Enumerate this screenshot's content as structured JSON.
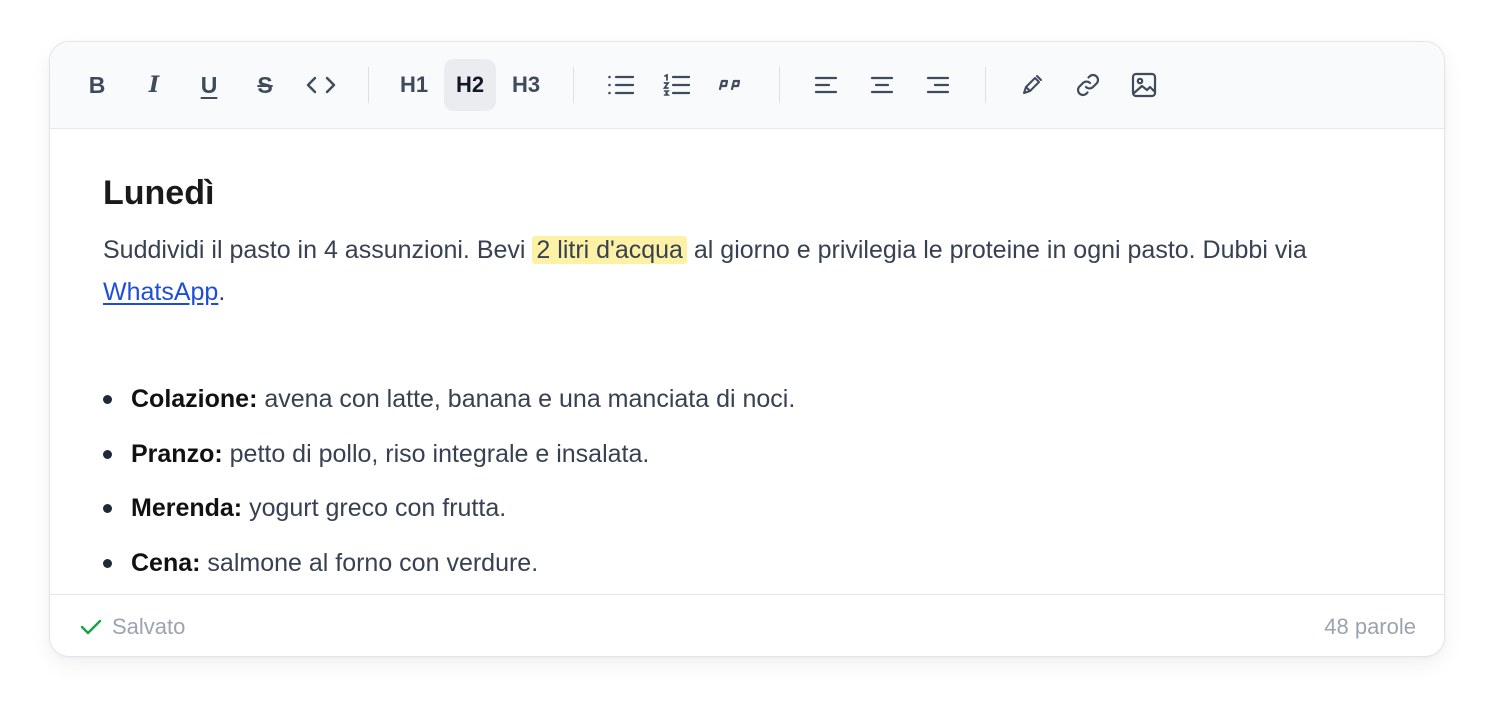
{
  "toolbar": {
    "bold": "B",
    "italic": "I",
    "underline": "U",
    "strike": "S",
    "h1": "H1",
    "h2": "H2",
    "h3": "H3",
    "active_heading": "H2",
    "icons": [
      "code-icon",
      "bullet-list-icon",
      "numbered-list-icon",
      "quote-icon",
      "align-left-icon",
      "align-center-icon",
      "align-right-icon",
      "highlighter-icon",
      "link-icon",
      "image-icon"
    ]
  },
  "document": {
    "title": "Lunedì",
    "paragraph": {
      "before_highlight": "Suddividi il pasto in 4 assunzioni. Bevi ",
      "highlight": "2 litri d'acqua",
      "after_highlight": " al giorno e privilegia le proteine in ogni pasto. Dubbi via ",
      "link": "WhatsApp",
      "end": "."
    },
    "meals": [
      {
        "label": "Colazione:",
        "text": " avena con latte, banana e una manciata di noci."
      },
      {
        "label": "Pranzo:",
        "text": " petto di pollo, riso integrale e insalata."
      },
      {
        "label": "Merenda:",
        "text": " yogurt greco con frutta."
      },
      {
        "label": "Cena:",
        "text": " salmone al forno con verdure."
      }
    ]
  },
  "footer": {
    "status": "Salvato",
    "word_count": "48 parole"
  },
  "colors": {
    "highlight": "#fdf1a6",
    "link": "#1d4ed8",
    "saved_check": "#16a34a",
    "toolbar_bg": "#f8fafc"
  }
}
